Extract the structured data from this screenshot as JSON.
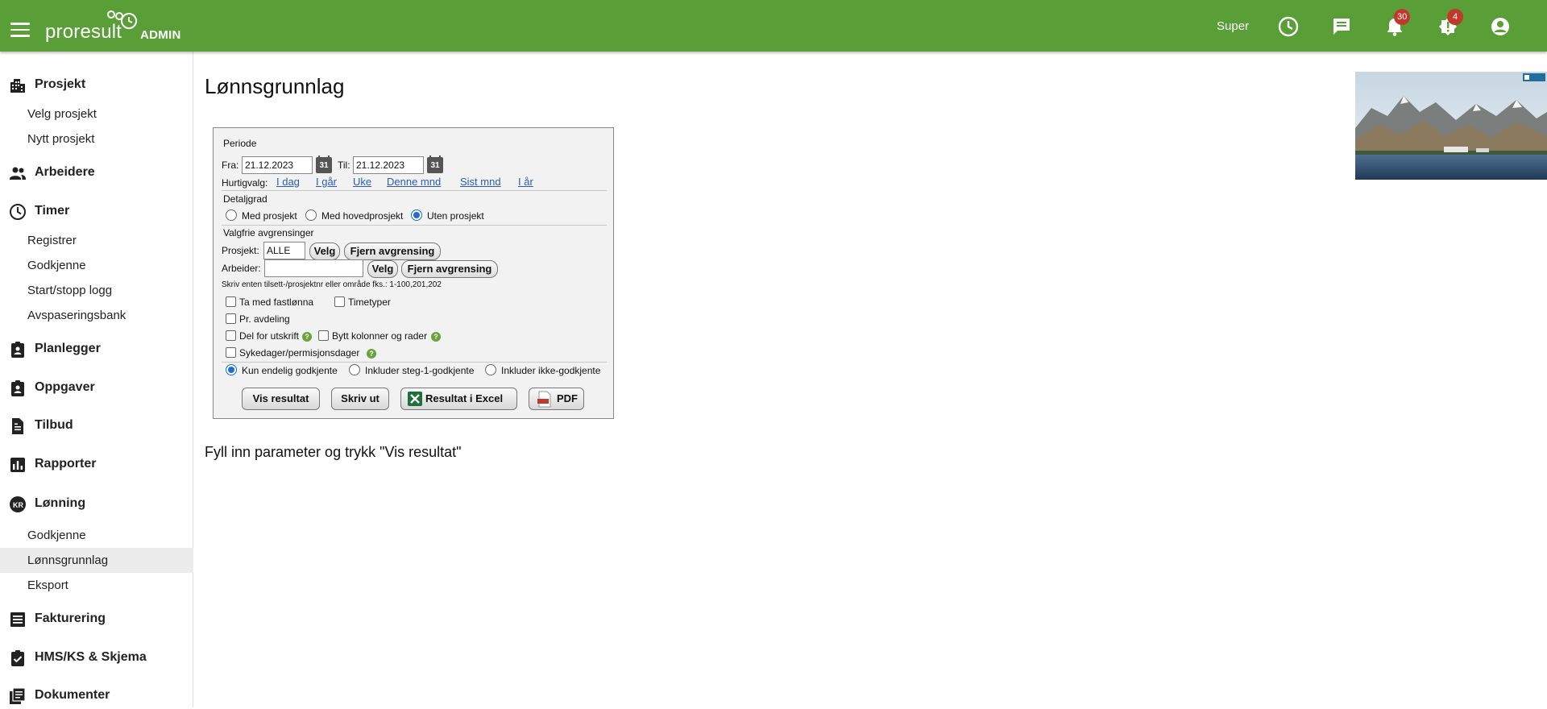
{
  "header": {
    "brand": "proresult",
    "admin_label": "ADMIN",
    "user_name": "Super",
    "icons": [
      "menu-icon",
      "clock-icon",
      "chat-icon",
      "bell-icon",
      "alert-icon",
      "account-icon"
    ],
    "bell_badge": "30",
    "alert_badge": "4",
    "bar_color": "#5a9e37"
  },
  "sidebar": {
    "prosjekt": "Prosjekt",
    "velg_prosjekt": "Velg prosjekt",
    "nytt_prosjekt": "Nytt prosjekt",
    "arbeidere": "Arbeidere",
    "timer": "Timer",
    "registrer": "Registrer",
    "godkjenne": "Godkjenne",
    "start_stopp": "Start/stopp logg",
    "avspasering": "Avspaseringsbank",
    "planlegger": "Planlegger",
    "oppgaver": "Oppgaver",
    "tilbud": "Tilbud",
    "rapporter": "Rapporter",
    "lonning": "Lønning",
    "lonning_badge": "KR",
    "lonn_godkjenne": "Godkjenne",
    "lonnsgrunnlag": "Lønnsgrunnlag",
    "eksport": "Eksport",
    "fakturering": "Fakturering",
    "hms": "HMS/KS & Skjema",
    "dokumenter": "Dokumenter"
  },
  "main": {
    "title": "Lønnsgrunnlag",
    "hint": "Fyll inn parameter og trykk \"Vis resultat\""
  },
  "form": {
    "periode": "Periode",
    "fra_label": "Fra:",
    "fra_value": "21.12.2023",
    "til_label": "Til:",
    "til_value": "21.12.2023",
    "cal_day": "31",
    "hurtigvalg": "Hurtigvalg:",
    "quick": [
      "I dag",
      "I går",
      "Uke",
      "Denne mnd",
      "Sist mnd",
      "I år"
    ],
    "detaljgrad": "Detaljgrad",
    "detail_options": [
      "Med prosjekt",
      "Med hovedprosjekt",
      "Uten prosjekt"
    ],
    "detail_selected": "Uten prosjekt",
    "valgfrie": "Valgfrie avgrensinger",
    "prosjekt_label": "Prosjekt:",
    "prosjekt_value": "ALLE",
    "arbeider_label": "Arbeider:",
    "arbeider_value": "",
    "velg": "Velg",
    "fjern": "Fjern avgrensing",
    "skriv_hint": "Skriv enten tilsett-/prosjektnr eller område fks.: 1-100,201,202",
    "checks": {
      "fastlonna": "Ta med fastlønna",
      "timetyper": "Timetyper",
      "avdeling": "Pr. avdeling",
      "del_utskrift": "Del for utskrift",
      "bytt": "Bytt kolonner og rader",
      "sykedager": "Sykedager/permisjonsdager"
    },
    "approval_options": [
      "Kun endelig godkjente",
      "Inkluder steg-1-godkjente",
      "Inkluder ikke-godkjente"
    ],
    "approval_selected": "Kun endelig godkjente",
    "help_glyph": "?",
    "buttons": {
      "vis": "Vis resultat",
      "skriv": "Skriv ut",
      "excel": "Resultat i Excel",
      "pdf": "PDF"
    }
  }
}
